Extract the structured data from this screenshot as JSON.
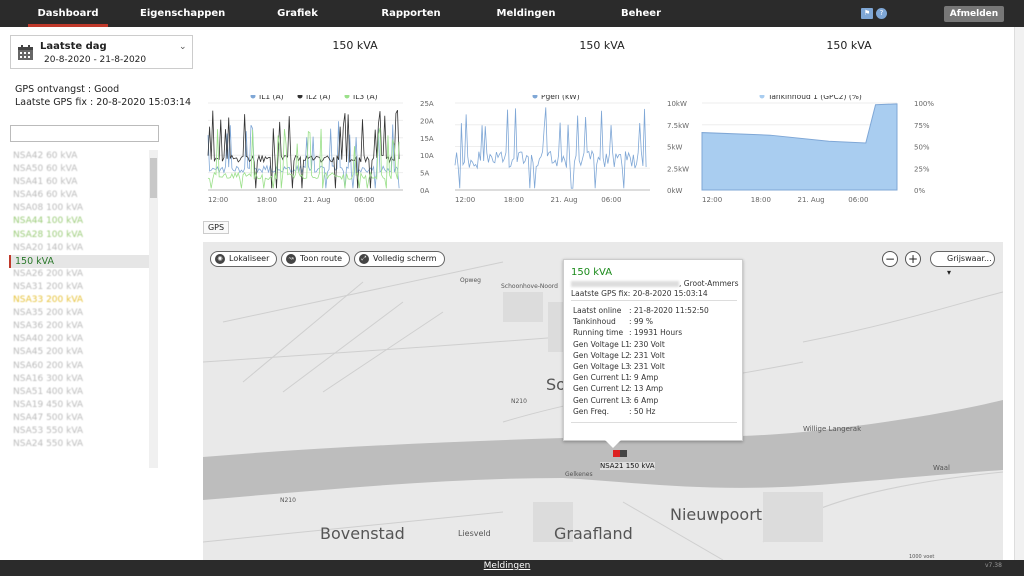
{
  "nav": {
    "items": [
      "Dashboard",
      "Eigenschappen",
      "Grafiek",
      "Rapporten",
      "Meldingen",
      "Beheer"
    ],
    "logout": "Afmelden"
  },
  "date": {
    "title": "Laatste dag",
    "range": "20-8-2020 - 21-8-2020"
  },
  "gps": {
    "reception_label": "GPS ontvangst",
    "reception_value": "Good",
    "lastfix_label": "Laatste GPS fix",
    "lastfix_value": "20-8-2020 15:03:14"
  },
  "unit_list": {
    "selected": "150 kVA",
    "items_before": [
      {
        "label": "NSA42 60 kVA",
        "tone": "g0"
      },
      {
        "label": "NSA50 60 kVA",
        "tone": "g0"
      },
      {
        "label": "NSA41 60 kVA",
        "tone": "g0"
      },
      {
        "label": "NSA46 60 kVA",
        "tone": "g0"
      },
      {
        "label": "NSA08 100 kVA",
        "tone": "g0"
      },
      {
        "label": "NSA44 100 kVA",
        "tone": "g"
      },
      {
        "label": "NSA28 100 kVA",
        "tone": "g"
      },
      {
        "label": "NSA20 140 kVA",
        "tone": "g0"
      }
    ],
    "items_after": [
      {
        "label": "NSA26 200 kVA",
        "tone": "g0"
      },
      {
        "label": "NSA31 200 kVA",
        "tone": "g0"
      },
      {
        "label": "NSA33 200 kVA",
        "tone": "o"
      },
      {
        "label": "NSA35 200 kVA",
        "tone": "g0"
      },
      {
        "label": "NSA36 200 kVA",
        "tone": "g0"
      },
      {
        "label": "NSA40 200 kVA",
        "tone": "g0"
      },
      {
        "label": "NSA45 200 kVA",
        "tone": "g0"
      },
      {
        "label": "NSA60 200 kVA",
        "tone": "g0"
      },
      {
        "label": "NSA16 300 kVA",
        "tone": "g0"
      },
      {
        "label": "NSA51 400 kVA",
        "tone": "g0"
      },
      {
        "label": "NSA19 450 kVA",
        "tone": "g0"
      },
      {
        "label": "NSA47 500 kVA",
        "tone": "g0"
      },
      {
        "label": "NSA53 550 kVA",
        "tone": "g0"
      },
      {
        "label": "NSA24 550 kVA",
        "tone": "g0"
      }
    ]
  },
  "kva_headers": [
    "150 kVA",
    "150 kVA",
    "150 kVA"
  ],
  "chart_data": [
    {
      "type": "line",
      "series": [
        {
          "name": "IL1 (A)",
          "color": "#7fa7d6"
        },
        {
          "name": "IL2 (A)",
          "color": "#333333"
        },
        {
          "name": "IL3 (A)",
          "color": "#9be08a"
        }
      ],
      "x_ticks": [
        "12:00",
        "18:00",
        "21. Aug",
        "06:00"
      ],
      "y_ticks": [
        "0A",
        "5A",
        "10A",
        "15A",
        "20A",
        "25A"
      ],
      "ylim": [
        0,
        25
      ]
    },
    {
      "type": "line",
      "series": [
        {
          "name": "Pgen (kW)",
          "color": "#7fa7d6"
        }
      ],
      "x_ticks": [
        "12:00",
        "18:00",
        "21. Aug",
        "06:00"
      ],
      "y_ticks": [
        "0kW",
        "2.5kW",
        "5kW",
        "7.5kW",
        "10kW"
      ],
      "ylim": [
        0,
        10
      ]
    },
    {
      "type": "area",
      "series": [
        {
          "name": "Tankinhoud 1 (GPC2) (%)",
          "color": "#a9cdf0"
        }
      ],
      "x_ticks": [
        "12:00",
        "18:00",
        "21. Aug",
        "06:00"
      ],
      "y_ticks": [
        "0%",
        "25%",
        "50%",
        "75%",
        "100%"
      ],
      "ylim": [
        0,
        100
      ],
      "values": [
        [
          0,
          66
        ],
        [
          0.35,
          63
        ],
        [
          0.65,
          56
        ],
        [
          0.84,
          54
        ],
        [
          0.89,
          98
        ],
        [
          1,
          99
        ]
      ]
    }
  ],
  "gps_tab": "GPS",
  "map": {
    "buttons": {
      "locate": "Lokaliseer",
      "route": "Toon route",
      "fullscreen": "Volledig scherm"
    },
    "layer": "Grijswaar...",
    "places": {
      "bovenstad": "Bovenstad",
      "graafland": "Graafland",
      "nieuwpoort": "Nieuwpoort",
      "liesveld": "Liesveld",
      "langerak": "Willige Langerak",
      "waal": "Waal",
      "road1": "N210",
      "road2": "N210",
      "school": "Schoonhove-Noord",
      "so": "So",
      "gelkenes": "Gelkenes",
      "opweg": "Opweg"
    },
    "marker_label": "NSA21 150 kVA",
    "scale": "1000 voet",
    "popup": {
      "title": "150 kVA",
      "address": ", Groot-Ammers",
      "lastfix": "Laatste GPS fix: 20-8-2020 15:03:14",
      "rows": [
        [
          "Laatst online",
          ": 21-8-2020 11:52:50"
        ],
        [
          "Tankinhoud",
          ": 99 %"
        ],
        [
          "Running time",
          ": 19931 Hours"
        ],
        [
          "Gen Voltage L1",
          ": 230 Volt"
        ],
        [
          "Gen Voltage L2",
          ": 231 Volt"
        ],
        [
          "Gen Voltage L3",
          ": 231 Volt"
        ],
        [
          "Gen Current L1",
          ": 9 Amp"
        ],
        [
          "Gen Current L2",
          ": 13 Amp"
        ],
        [
          "Gen Current L3",
          ": 6 Amp"
        ],
        [
          "Gen Freq.",
          ": 50 Hz"
        ]
      ]
    }
  },
  "footer": {
    "link": "Meldingen",
    "version": "v7.38"
  }
}
